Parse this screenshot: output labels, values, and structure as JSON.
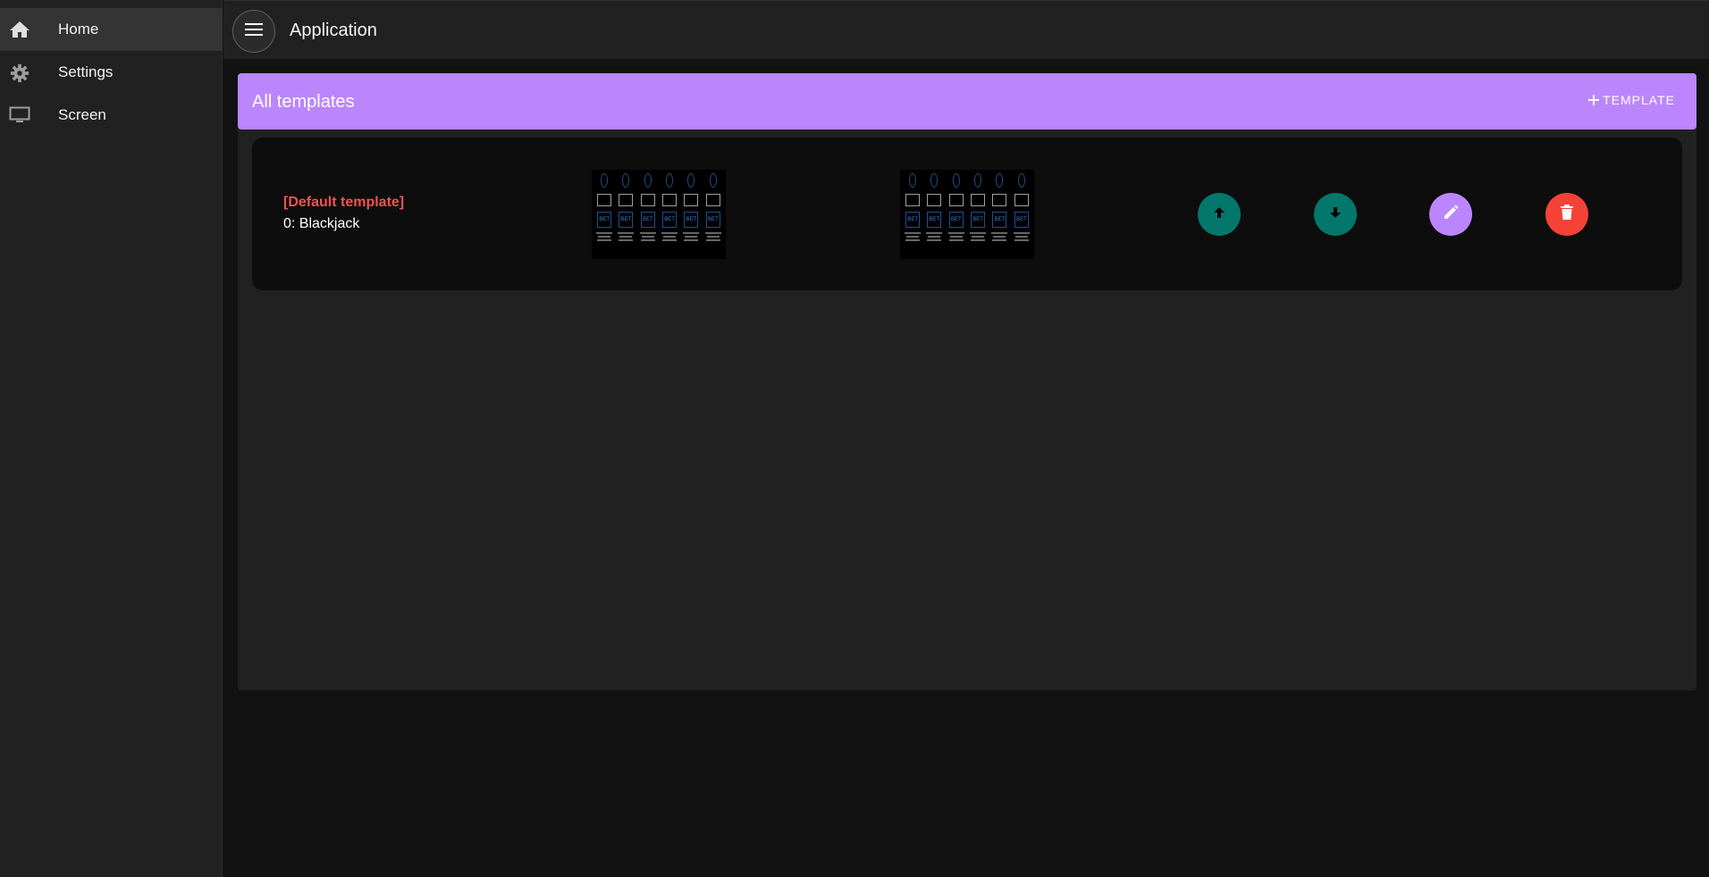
{
  "sidebar": {
    "items": [
      {
        "label": "Home",
        "icon": "home-icon",
        "active": true
      },
      {
        "label": "Settings",
        "icon": "gear-icon",
        "active": false
      },
      {
        "label": "Screen",
        "icon": "monitor-icon",
        "active": false
      }
    ]
  },
  "topbar": {
    "title": "Application"
  },
  "panel": {
    "title": "All templates",
    "add_button_label": "TEMPLATE",
    "add_button_icon": "plus-icon"
  },
  "templates": [
    {
      "tag": "[Default template]",
      "name": "0: Blackjack",
      "thumbnail_bet_label": "BET",
      "actions": [
        {
          "name": "move-up-button",
          "icon": "arrow-up-icon",
          "color": "#03776c"
        },
        {
          "name": "move-down-button",
          "icon": "arrow-down-icon",
          "color": "#03776c"
        },
        {
          "name": "edit-button",
          "icon": "pencil-icon",
          "color": "#bb86fc"
        },
        {
          "name": "delete-button",
          "icon": "trash-icon",
          "color": "#f44336"
        }
      ]
    }
  ],
  "colors": {
    "accent": "#bb86fc",
    "teal": "#03776c",
    "danger": "#f44336",
    "default_tag": "#ef5350"
  }
}
